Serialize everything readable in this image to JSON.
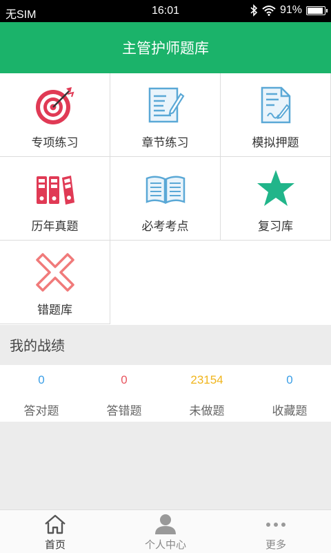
{
  "status_bar": {
    "carrier": "无SIM",
    "time": "16:01",
    "battery": "91%",
    "battery_level": 0.91
  },
  "app_bar": {
    "title": "主管护师题库"
  },
  "menu": [
    {
      "label": "专项练习",
      "icon": "target-icon"
    },
    {
      "label": "章节练习",
      "icon": "document-pen-icon"
    },
    {
      "label": "模拟押题",
      "icon": "exam-paper-icon"
    },
    {
      "label": "历年真题",
      "icon": "binders-icon"
    },
    {
      "label": "必考考点",
      "icon": "open-book-icon"
    },
    {
      "label": "复习库",
      "icon": "star-icon"
    },
    {
      "label": "错题库",
      "icon": "cross-icon"
    }
  ],
  "stats": {
    "title": "我的战绩",
    "items": [
      {
        "value": "0",
        "label": "答对题",
        "color": "#3a9ee6"
      },
      {
        "value": "0",
        "label": "答错题",
        "color": "#e8555f"
      },
      {
        "value": "23154",
        "label": "未做题",
        "color": "#f0b51c"
      },
      {
        "value": "0",
        "label": "收藏题",
        "color": "#3a9ee6"
      }
    ]
  },
  "tabs": [
    {
      "label": "首页",
      "icon": "home-icon"
    },
    {
      "label": "个人中心",
      "icon": "person-icon"
    },
    {
      "label": "更多",
      "icon": "more-dots-icon"
    }
  ],
  "colors": {
    "brand": "#1bb36a",
    "red": "#e03a55",
    "blue": "#5aa8d6",
    "star": "#21b58a",
    "cross": "#f07a7a"
  }
}
